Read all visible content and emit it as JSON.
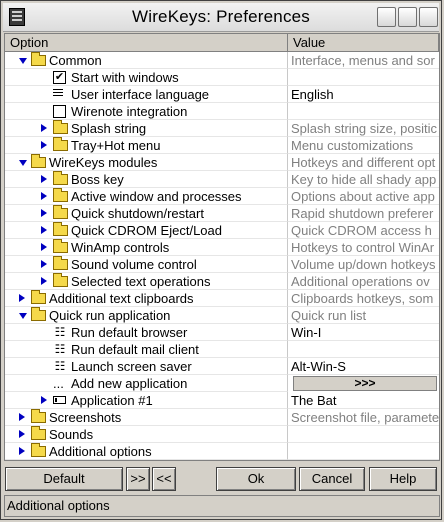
{
  "window": {
    "title": "WireKeys: Preferences"
  },
  "columns": {
    "option": "Option",
    "value": "Value"
  },
  "rows": [
    {
      "label": "Common",
      "value": "Interface, menus and sor",
      "icon": "folder",
      "expand": "down",
      "level": 0,
      "gray": true
    },
    {
      "label": "Start with windows",
      "value": "",
      "icon": "checkbox-checked",
      "expand": "",
      "level": 1,
      "gray": true
    },
    {
      "label": "User interface language",
      "value": "English",
      "icon": "list",
      "expand": "",
      "level": 1,
      "gray": false
    },
    {
      "label": "Wirenote integration",
      "value": "",
      "icon": "checkbox-empty",
      "expand": "",
      "level": 1,
      "gray": true
    },
    {
      "label": "Splash string",
      "value": "Splash string size, positic",
      "icon": "folder",
      "expand": "right",
      "level": 1,
      "gray": true
    },
    {
      "label": "Tray+Hot menu",
      "value": "Menu customizations",
      "icon": "folder",
      "expand": "right",
      "level": 1,
      "gray": true
    },
    {
      "label": "WireKeys modules",
      "value": "Hotkeys and different opt",
      "icon": "folder",
      "expand": "down",
      "level": 0,
      "gray": true
    },
    {
      "label": "Boss key",
      "value": "Key to hide all shady app",
      "icon": "folder",
      "expand": "right",
      "level": 1,
      "gray": true
    },
    {
      "label": "Active window and processes",
      "value": "Options about active app",
      "icon": "folder",
      "expand": "right",
      "level": 1,
      "gray": true
    },
    {
      "label": "Quick shutdown/restart",
      "value": "Rapid shutdown preferer",
      "icon": "folder",
      "expand": "right",
      "level": 1,
      "gray": true
    },
    {
      "label": "Quick CDROM Eject/Load",
      "value": "Quick CDROM access h",
      "icon": "folder",
      "expand": "right",
      "level": 1,
      "gray": true
    },
    {
      "label": "WinAmp controls",
      "value": "Hotkeys to control WinAr",
      "icon": "folder",
      "expand": "right",
      "level": 1,
      "gray": true
    },
    {
      "label": "Sound volume control",
      "value": "Volume up/down hotkeys",
      "icon": "folder",
      "expand": "right",
      "level": 1,
      "gray": true
    },
    {
      "label": "Selected text operations",
      "value": "Additional operations ov",
      "icon": "folder",
      "expand": "right",
      "level": 1,
      "gray": true
    },
    {
      "label": "Additional text clipboards",
      "value": "Clipboards hotkeys, som",
      "icon": "folder",
      "expand": "right",
      "level": 0,
      "gray": true
    },
    {
      "label": "Quick run application",
      "value": "Quick run list",
      "icon": "folder",
      "expand": "down",
      "level": 0,
      "gray": true
    },
    {
      "label": "Run default browser",
      "value": "Win-I",
      "icon": "person",
      "expand": "",
      "level": 1,
      "gray": false
    },
    {
      "label": "Run default mail client",
      "value": "",
      "icon": "person",
      "expand": "",
      "level": 1,
      "gray": false
    },
    {
      "label": "Launch screen saver",
      "value": "Alt-Win-S",
      "icon": "person",
      "expand": "",
      "level": 1,
      "gray": false
    },
    {
      "label": "Add new application",
      "value": ">>>",
      "icon": "dots",
      "expand": "",
      "level": 1,
      "gray": false,
      "button": true
    },
    {
      "label": "Application #1",
      "value": "The Bat",
      "icon": "rect",
      "expand": "right",
      "level": 1,
      "gray": false
    },
    {
      "label": "Screenshots",
      "value": "Screenshot file, paramete",
      "icon": "folder",
      "expand": "right",
      "level": 0,
      "gray": true
    },
    {
      "label": "Sounds",
      "value": "",
      "icon": "folder",
      "expand": "right",
      "level": 0,
      "gray": true
    },
    {
      "label": "Additional options",
      "value": "",
      "icon": "folder",
      "expand": "right",
      "level": 0,
      "gray": true
    }
  ],
  "buttons": {
    "default": "Default",
    "next": ">>",
    "prev": "<<",
    "ok": "Ok",
    "cancel": "Cancel",
    "help": "Help"
  },
  "status": {
    "text": "Additional options"
  },
  "colors": {
    "arrow": "#0000c0",
    "folder": "#f5d94a",
    "window_bg": "#d4d0c8"
  }
}
